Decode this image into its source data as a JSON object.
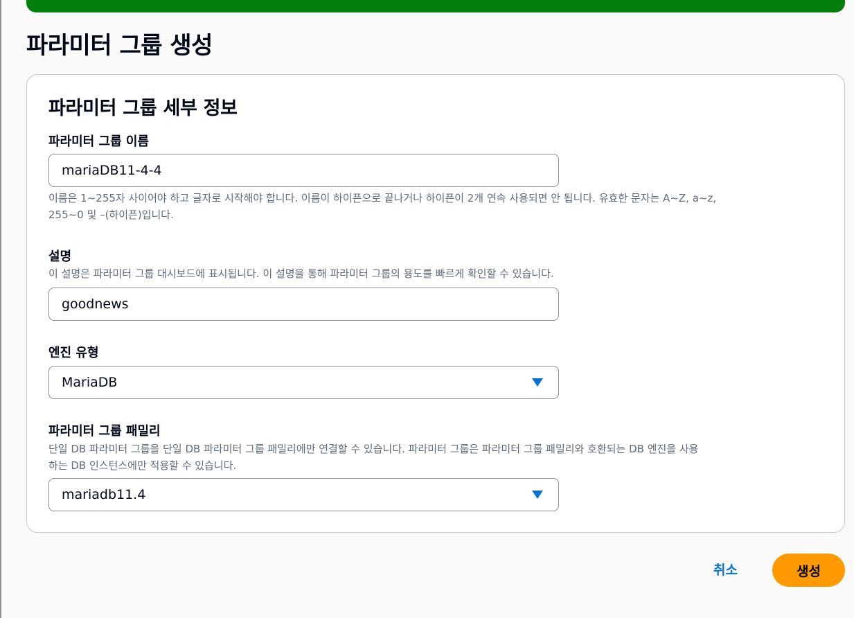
{
  "page": {
    "title": "파라미터 그룹 생성"
  },
  "panel": {
    "title": "파라미터 그룹 세부 정보"
  },
  "fields": {
    "name": {
      "label": "파라미터 그룹 이름",
      "value": "mariaDB11-4-4",
      "hint_line1": "이름은 1~255자 사이어야 하고 글자로 시작해야 합니다. 이름이 하이픈으로 끝나거나 하이픈이 2개 연속 사용되면 안 됩니다. 유효한 문자는 A~Z, a~z,",
      "hint_line2": "255~0 및 –(하이픈)입니다."
    },
    "description": {
      "label": "설명",
      "hint": "이 설명은 파라미터 그룹 대시보드에 표시됩니다. 이 설명을 통해 파라미터 그룹의 용도를 빠르게 확인할 수 있습니다.",
      "value": "goodnews"
    },
    "engine_type": {
      "label": "엔진 유형",
      "selected": "MariaDB"
    },
    "family": {
      "label": "파라미터 그룹 패밀리",
      "hint_line1": "단일 DB 파라미터 그룹을 단일 DB 파라미터 그룹 패밀리에만 연결할 수 있습니다. 파라미터 그룹은 파라미터 그룹 패밀리와 호환되는 DB 엔진을 사용",
      "hint_line2": "하는 DB 인스턴스에만 적용할 수 있습니다.",
      "selected": "mariadb11.4"
    }
  },
  "actions": {
    "cancel_label": "취소",
    "create_label": "생성"
  },
  "colors": {
    "banner": "#037f0c",
    "primary_button": "#ff9900",
    "link": "#0972d3",
    "caret": "#0972d3"
  },
  "icons": {
    "select_caret": "caret-down-icon"
  }
}
